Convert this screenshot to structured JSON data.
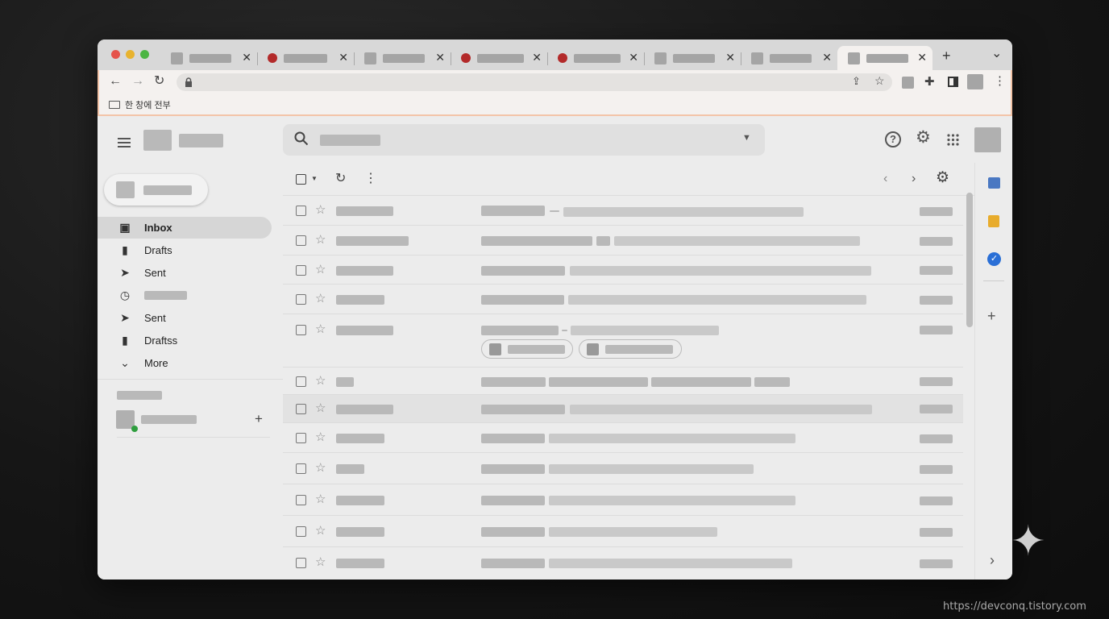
{
  "browser": {
    "tabs": [
      {
        "favicon": "page-icon"
      },
      {
        "favicon": "red-circle-icon"
      },
      {
        "favicon": "page-icon"
      },
      {
        "favicon": "red-circle-icon"
      },
      {
        "favicon": "red-circle-icon"
      },
      {
        "favicon": "page-icon"
      },
      {
        "favicon": "page-icon"
      },
      {
        "favicon": "page-icon",
        "active": true
      }
    ],
    "tab_close_glyph": "✕",
    "new_tab_glyph": "+",
    "tab_search_glyph": "⌄",
    "bookmark_folder_label": "한 창에 전부"
  },
  "gmail": {
    "nav": [
      {
        "label": "Inbox",
        "icon": "inbox-icon",
        "glyph": "▣",
        "active": true
      },
      {
        "label": "Drafts",
        "icon": "draft-file-icon",
        "glyph": "▮"
      },
      {
        "label": "Sent",
        "icon": "send-icon",
        "glyph": "➤"
      },
      {
        "label": "",
        "icon": "clock-icon",
        "glyph": "◷"
      },
      {
        "label": "Sent",
        "icon": "send-icon",
        "glyph": "➤"
      },
      {
        "label": "Draftss",
        "icon": "draft-file-icon",
        "glyph": "▮"
      },
      {
        "label": "More",
        "icon": "chevron-down-icon",
        "glyph": "⌄"
      }
    ],
    "add_label_glyph": "+",
    "colors": {
      "online_dot": "#2e9e3e",
      "calendar": "#4a78c2",
      "keep": "#e8ac2c",
      "tasks": "#2a6fd6"
    }
  },
  "watermark": "https://devconq.tistory.com"
}
